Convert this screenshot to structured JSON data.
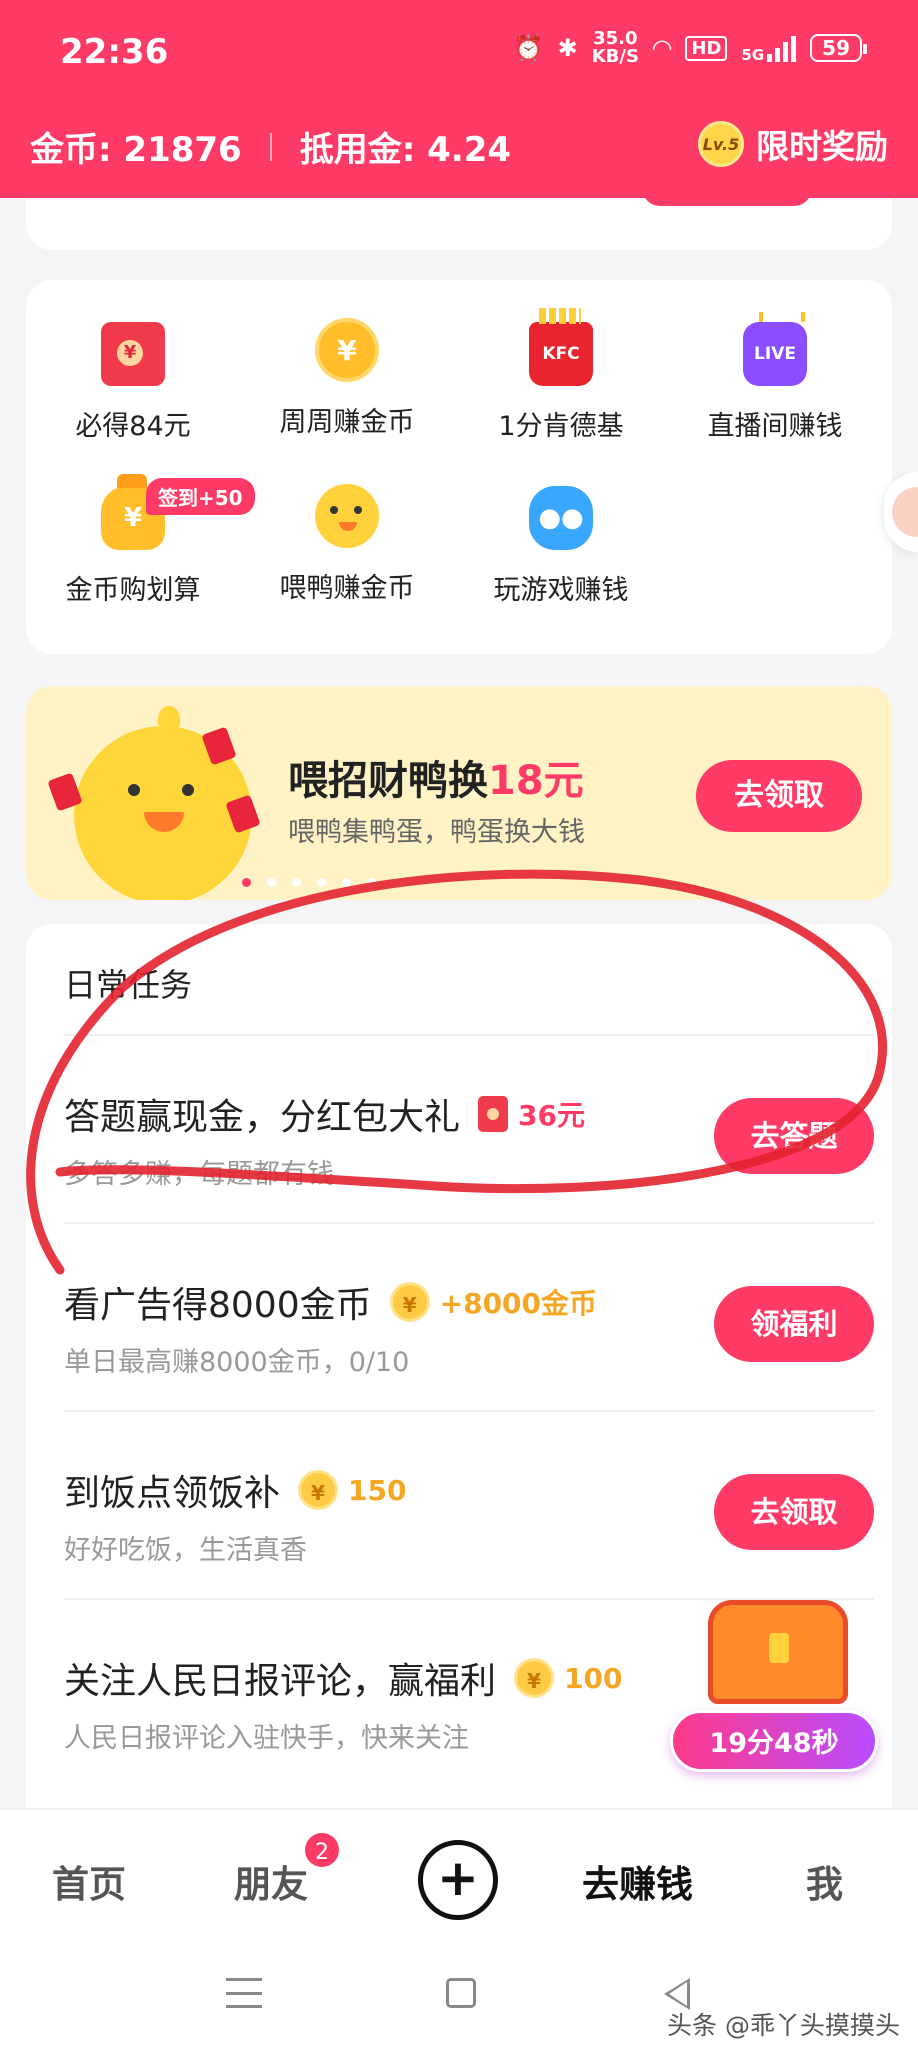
{
  "status": {
    "time": "22:36",
    "speed_value": "35.0",
    "speed_unit": "KB/S",
    "hd": "HD",
    "net": "5G",
    "battery": "59"
  },
  "header": {
    "coins": "金币: 21876",
    "deduct": "抵用金: 4.24",
    "level": "Lv.5",
    "reward_label": "限时奖励"
  },
  "grid": {
    "items": [
      {
        "label": "必得84元",
        "icon": "red-envelope-icon"
      },
      {
        "label": "周周赚金币",
        "icon": "coin-icon",
        "glyph": "¥"
      },
      {
        "label": "1分肯德基",
        "icon": "kfc-icon",
        "glyph": "KFC"
      },
      {
        "label": "直播间赚钱",
        "icon": "live-icon",
        "glyph": "LIVE"
      },
      {
        "label": "金币购划算",
        "icon": "money-bag-icon",
        "glyph": "¥"
      },
      {
        "label": "喂鸭赚金币",
        "icon": "duck-icon"
      },
      {
        "label": "玩游戏赚钱",
        "icon": "gamepad-icon",
        "glyph": "●●"
      }
    ],
    "sign_badge": "签到+50"
  },
  "banner": {
    "title_main": "喂招财鸭换",
    "title_highlight": "18元",
    "subtitle": "喂鸭集鸭蛋，鸭蛋换大钱",
    "button": "去领取"
  },
  "tasks": {
    "header": "日常任务",
    "items": [
      {
        "title": "答题赢现金，分红包大礼",
        "reward": "36元",
        "subtitle": "多答多赚，每题都有钱",
        "button": "去答题"
      },
      {
        "title": "看广告得8000金币",
        "reward": "+8000金币",
        "subtitle": "单日最高赚8000金币，0/10",
        "button": "领福利"
      },
      {
        "title": "到饭点领饭补",
        "reward": "150",
        "subtitle": "好好吃饭，生活真香",
        "button": "去领取"
      },
      {
        "title": "关注人民日报评论，赢福利",
        "reward": "100",
        "subtitle": "人民日报评论入驻快手，快来关注"
      }
    ]
  },
  "chest": {
    "timer": "19分48秒"
  },
  "nav": {
    "home": "首页",
    "friends": "朋友",
    "friends_badge": "2",
    "plus": "+",
    "earn": "去赚钱",
    "me": "我"
  },
  "watermark": "头条 @乖丫头摸摸头",
  "colors": {
    "brand": "#fe3b66",
    "gold": "#f5a623",
    "banner_bg": "#fff3c6"
  }
}
